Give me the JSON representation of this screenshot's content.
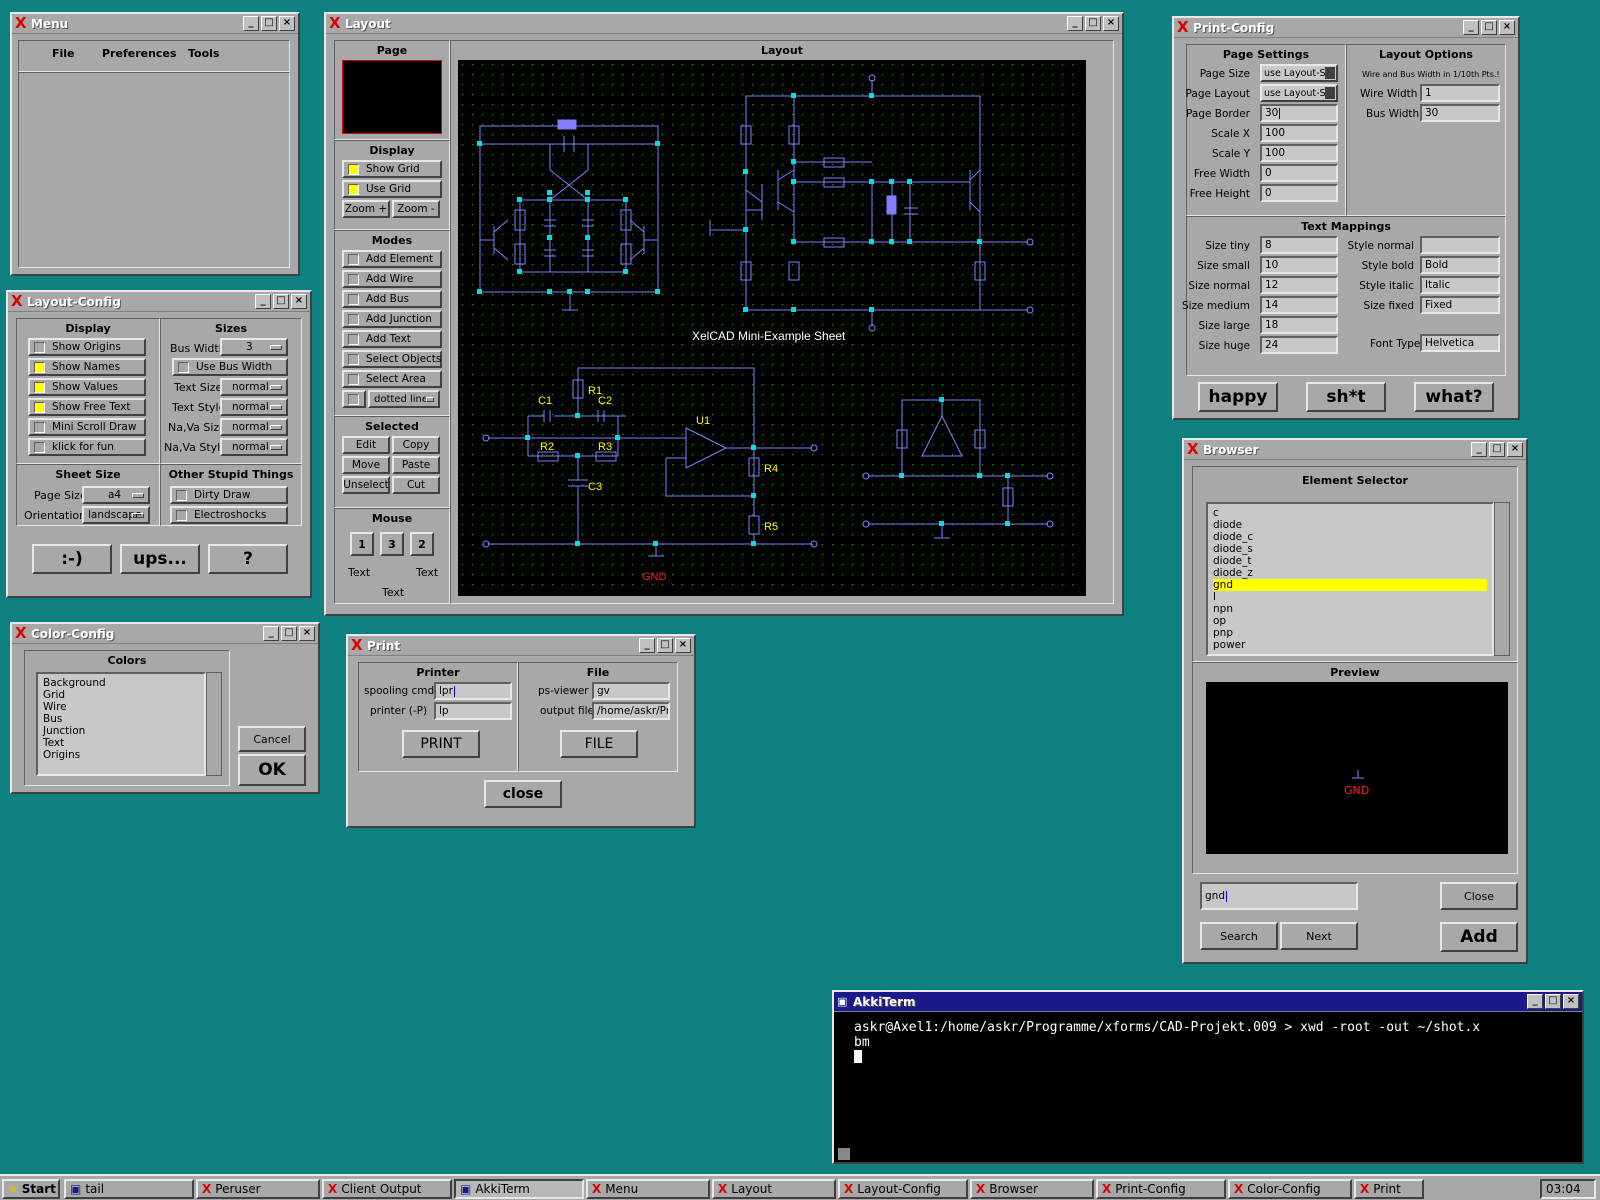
{
  "menu_win": {
    "title": "Menu",
    "items": [
      "File",
      "Preferences",
      "Tools"
    ]
  },
  "layout_config": {
    "title": "Layout-Config",
    "display_hdr": "Display",
    "display_items": [
      {
        "label": "Show Origins",
        "on": false
      },
      {
        "label": "Show Names",
        "on": true
      },
      {
        "label": "Show Values",
        "on": true
      },
      {
        "label": "Show Free Text",
        "on": true
      },
      {
        "label": "Mini Scroll Draw",
        "on": false
      },
      {
        "label": "klick for fun",
        "on": false
      }
    ],
    "sizes_hdr": "Sizes",
    "bus_width_lbl": "Bus Width",
    "bus_width_val": "3",
    "use_bus_width": "Use Bus Width",
    "text_size_lbl": "Text Size",
    "text_size_val": "normal",
    "text_style_lbl": "Text Style",
    "text_style_val": "normal",
    "nava_size_lbl": "Na,Va Size",
    "nava_size_val": "normal",
    "nava_style_lbl": "Na,Va Style",
    "nava_style_val": "normal",
    "sheet_hdr": "Sheet Size",
    "page_size_lbl": "Page Size",
    "page_size_val": "a4",
    "orientation_lbl": "Orientation",
    "orientation_val": "landscape",
    "other_hdr": "Other Stupid Things",
    "dirty_draw": "Dirty Draw",
    "electroshocks": "Electroshocks",
    "btn1": ":-)",
    "btn2": "ups...",
    "btn3": "?"
  },
  "color_config": {
    "title": "Color-Config",
    "hdr": "Colors",
    "items": [
      "Background",
      "Grid",
      "Wire",
      "Bus",
      "Junction",
      "Text",
      "Origins"
    ],
    "cancel": "Cancel",
    "ok": "OK"
  },
  "layout": {
    "title": "Layout",
    "page_hdr": "Page",
    "display_hdr": "Display",
    "show_grid": "Show Grid",
    "use_grid": "Use Grid",
    "zoom_plus": "Zoom +",
    "zoom_minus": "Zoom -",
    "modes_hdr": "Modes",
    "modes": [
      "Add Element",
      "Add Wire",
      "Add Bus",
      "Add Junction",
      "Add Text",
      "Select Objects",
      "Select Area"
    ],
    "line_style": "dotted line",
    "selected_hdr": "Selected",
    "edit": "Edit",
    "copy": "Copy",
    "move": "Move",
    "paste": "Paste",
    "unselect": "Unselect",
    "cut": "Cut",
    "mouse_hdr": "Mouse",
    "mouse_btns": [
      "1",
      "3",
      "2"
    ],
    "mouse_text_l": "Text",
    "mouse_text_r": "Text",
    "mouse_text_b": "Text",
    "canvas_hdr": "Layout",
    "sheet_title": "XelCAD Mini-Example Sheet",
    "labels": {
      "c1": "C1",
      "c2": "C2",
      "r1": "R1",
      "r2": "R2",
      "r3": "R3",
      "c3": "C3",
      "u1": "U1",
      "r4": "R4",
      "r5": "R5",
      "gnd": "GND"
    }
  },
  "print_config": {
    "title": "Print-Config",
    "page_hdr": "Page Settings",
    "layout_hdr": "Layout Options",
    "page_size_lbl": "Page Size",
    "page_size_val": "use Layout-Se",
    "page_layout_lbl": "Page Layout",
    "page_layout_val": "use Layout-Se",
    "page_border_lbl": "Page Border",
    "page_border_val": "30",
    "scale_x_lbl": "Scale X",
    "scale_x_val": "100",
    "scale_y_lbl": "Scale Y",
    "scale_y_val": "100",
    "free_width_lbl": "Free Width",
    "free_width_val": "0",
    "free_height_lbl": "Free Height",
    "free_height_val": "0",
    "wire_note": "Wire and Bus Width in 1/10th Pts.!",
    "wire_width_lbl": "Wire Width",
    "wire_width_val": "1",
    "bus_width_lbl": "Bus Width",
    "bus_width_val": "30",
    "text_hdr": "Text Mappings",
    "sizes": [
      {
        "l": "Size tiny",
        "v": "8"
      },
      {
        "l": "Size small",
        "v": "10"
      },
      {
        "l": "Size normal",
        "v": "12"
      },
      {
        "l": "Size medium",
        "v": "14"
      },
      {
        "l": "Size large",
        "v": "18"
      },
      {
        "l": "Size huge",
        "v": "24"
      }
    ],
    "styles": [
      {
        "l": "Style normal",
        "v": ""
      },
      {
        "l": "Style bold",
        "v": "Bold"
      },
      {
        "l": "Style italic",
        "v": "Italic"
      },
      {
        "l": "Size fixed",
        "v": "Fixed"
      }
    ],
    "font_type_lbl": "Font Type",
    "font_type_val": "Helvetica",
    "happy": "happy",
    "shit": "sh*t",
    "what": "what?"
  },
  "browser": {
    "title": "Browser",
    "selector_hdr": "Element Selector",
    "items": [
      "c",
      "diode",
      "diode_c",
      "diode_s",
      "diode_t",
      "diode_z",
      "gnd",
      "l",
      "npn",
      "op",
      "pnp",
      "power"
    ],
    "selected": "gnd",
    "preview_hdr": "Preview",
    "preview_label": "GND",
    "search_val": "gnd",
    "close": "Close",
    "search": "Search",
    "next": "Next",
    "add": "Add"
  },
  "print": {
    "title": "Print",
    "printer_hdr": "Printer",
    "file_hdr": "File",
    "spool_lbl": "spooling cmd",
    "spool_val": "lpr",
    "printer_lbl": "printer (-P)",
    "printer_val": "lp",
    "psviewer_lbl": "ps-viewer",
    "psviewer_val": "gv",
    "outfile_lbl": "output file",
    "outfile_val": "/home/askr/Prc",
    "print_btn": "PRINT",
    "file_btn": "FILE",
    "close": "close"
  },
  "term": {
    "title": "AkkiTerm",
    "line1": "askr@Axel1:/home/askr/Programme/xforms/CAD-Projekt.009 > xwd -root -out ~/shot.x",
    "line2": "bm"
  },
  "taskbar": {
    "start": "Start",
    "tasks": [
      "tail",
      "Peruser",
      "Client Output",
      "AkkiTerm",
      "Menu",
      "Layout",
      "Layout-Config",
      "Browser",
      "Print-Config",
      "Color-Config",
      "Print"
    ],
    "clock": "03:04"
  },
  "colors": {
    "desktop": "#0e8080",
    "wire": "#8080ff",
    "junction": "#00e0e0",
    "label": "#ffff00",
    "gnd": "#ff2020"
  }
}
